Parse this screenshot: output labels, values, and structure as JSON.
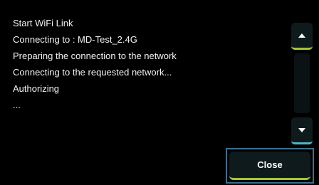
{
  "log": {
    "lines": [
      "Start WiFi Link",
      "Connecting to : MD-Test_2.4G",
      "Preparing the connection to the network",
      "Connecting to the requested network...",
      "Authorizing",
      "..."
    ]
  },
  "scroll": {
    "up_icon": "caret-up-icon",
    "down_icon": "caret-down-icon"
  },
  "actions": {
    "close_label": "Close"
  },
  "colors": {
    "background": "#000000",
    "text": "#f2f2f2",
    "button_bg": "#0f1a1c",
    "accent_green": "#a4c639",
    "accent_cyan": "#4fb6c6",
    "focus_border": "#3d6f8f"
  }
}
